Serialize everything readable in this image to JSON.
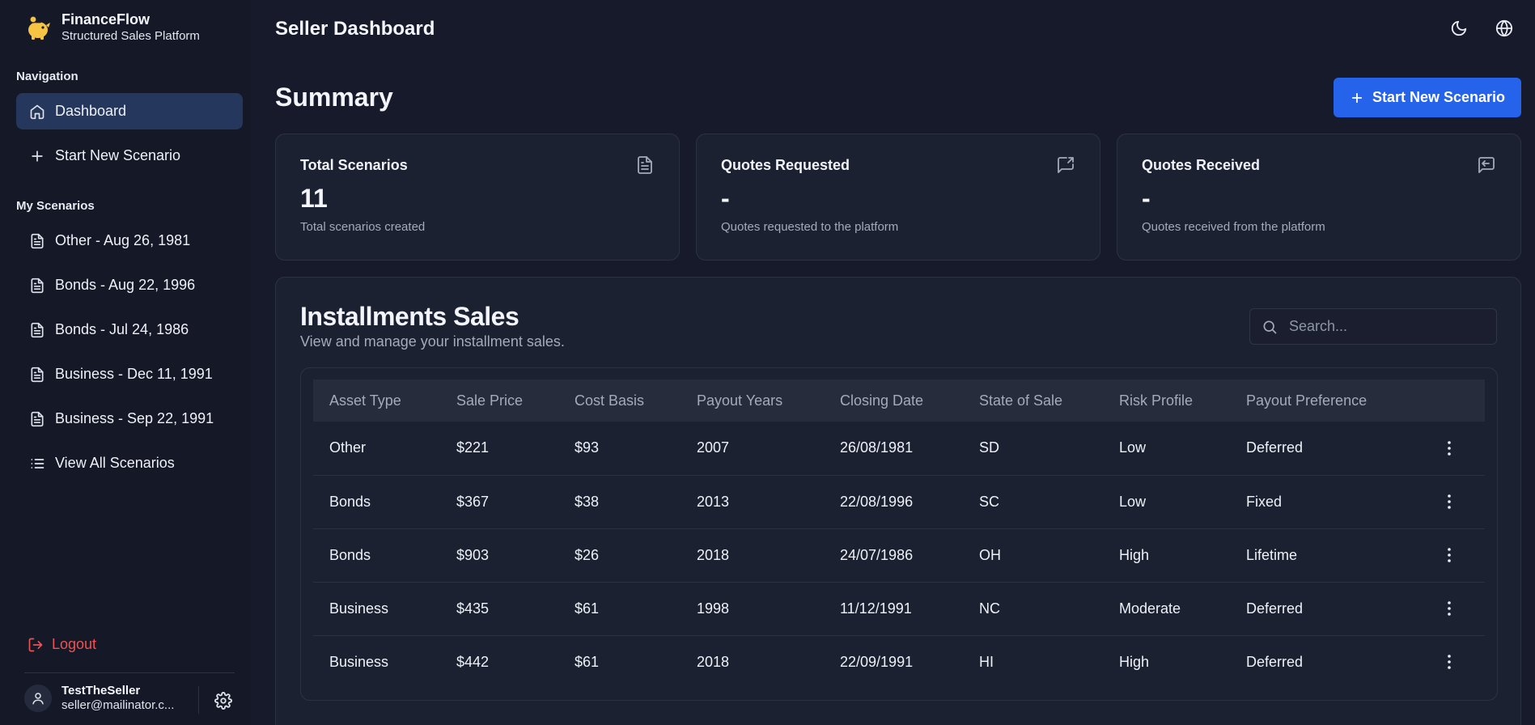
{
  "brand": {
    "name": "FinanceFlow",
    "subtitle": "Structured Sales Platform"
  },
  "sidebar": {
    "nav_title": "Navigation",
    "nav_items": [
      {
        "label": "Dashboard",
        "icon": "home-icon",
        "active": true
      },
      {
        "label": "Start New Scenario",
        "icon": "plus-icon"
      }
    ],
    "scenarios_title": "My Scenarios",
    "scenarios": [
      {
        "label": "Other - Aug 26, 1981"
      },
      {
        "label": "Bonds - Aug 22, 1996"
      },
      {
        "label": "Bonds - Jul 24, 1986"
      },
      {
        "label": "Business - Dec 11, 1991"
      },
      {
        "label": "Business - Sep 22, 1991"
      }
    ],
    "view_all": "View All Scenarios",
    "logout": "Logout",
    "user": {
      "name": "TestTheSeller",
      "email": "seller@mailinator.c..."
    }
  },
  "header": {
    "title": "Seller Dashboard"
  },
  "summary": {
    "title": "Summary",
    "new_button": "Start New Scenario",
    "cards": [
      {
        "title": "Total Scenarios",
        "value": "11",
        "desc": "Total scenarios created",
        "icon": "file-text-icon"
      },
      {
        "title": "Quotes Requested",
        "value": "-",
        "desc": "Quotes requested to the platform",
        "icon": "message-forward-icon"
      },
      {
        "title": "Quotes Received",
        "value": "-",
        "desc": "Quotes received from the platform",
        "icon": "message-reply-icon"
      }
    ]
  },
  "installments": {
    "title": "Installments Sales",
    "subtitle": "View and manage your installment sales.",
    "search_placeholder": "Search...",
    "columns": [
      "Asset Type",
      "Sale Price",
      "Cost Basis",
      "Payout Years",
      "Closing Date",
      "State of Sale",
      "Risk Profile",
      "Payout Preference"
    ],
    "rows": [
      [
        "Other",
        "$221",
        "$93",
        "2007",
        "26/08/1981",
        "SD",
        "Low",
        "Deferred"
      ],
      [
        "Bonds",
        "$367",
        "$38",
        "2013",
        "22/08/1996",
        "SC",
        "Low",
        "Fixed"
      ],
      [
        "Bonds",
        "$903",
        "$26",
        "2018",
        "24/07/1986",
        "OH",
        "High",
        "Lifetime"
      ],
      [
        "Business",
        "$435",
        "$61",
        "1998",
        "11/12/1991",
        "NC",
        "Moderate",
        "Deferred"
      ],
      [
        "Business",
        "$442",
        "$61",
        "2018",
        "22/09/1991",
        "HI",
        "High",
        "Deferred"
      ]
    ]
  },
  "colors": {
    "accent": "#2563eb",
    "danger": "#f05252",
    "background": "#161a2a",
    "card": "#1c2132"
  }
}
